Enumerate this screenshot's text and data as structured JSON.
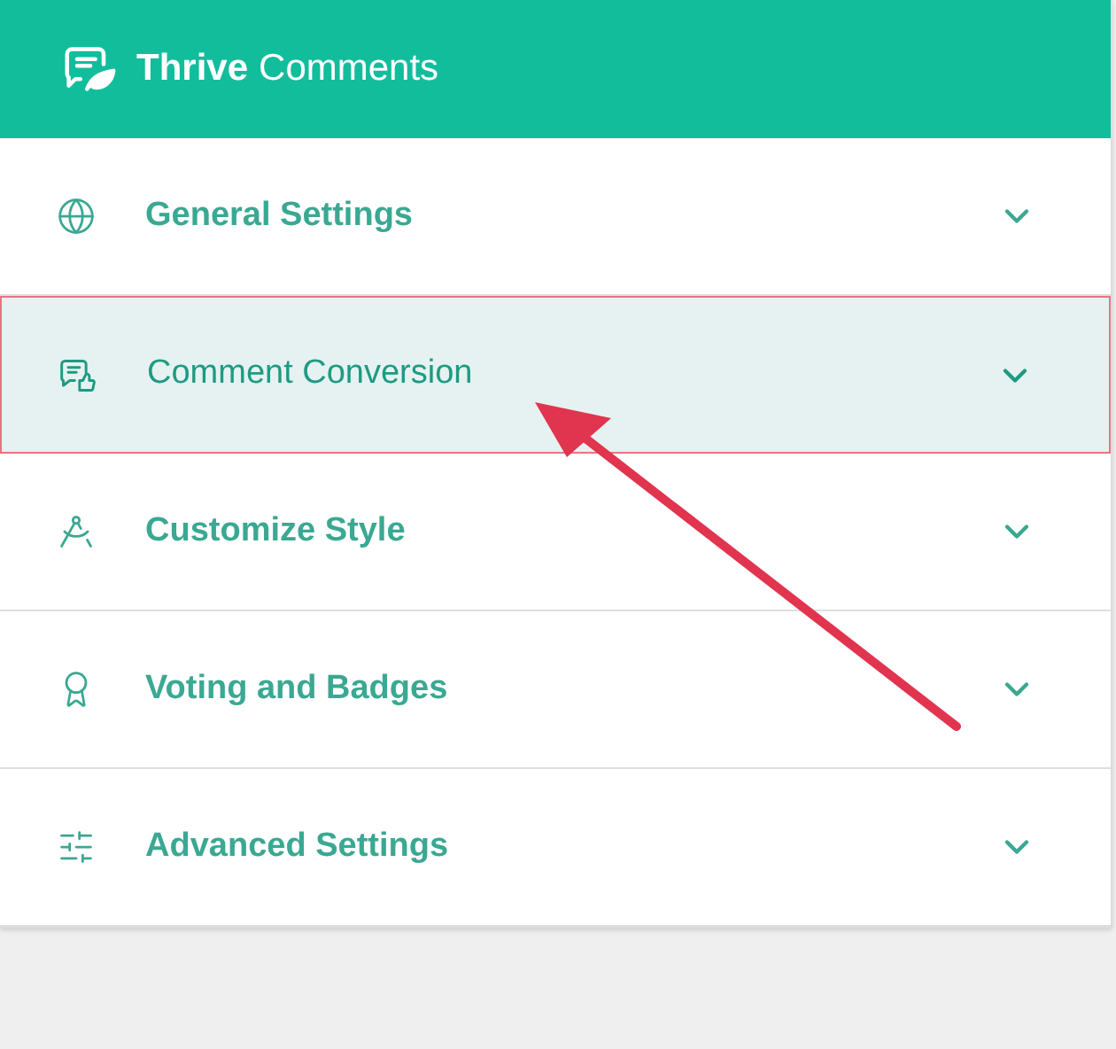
{
  "header": {
    "title_bold": "Thrive",
    "title_light": "Comments"
  },
  "menu": [
    {
      "label": "General Settings",
      "kind": "globe",
      "selected": false,
      "blurred": true
    },
    {
      "label": "Comment Conversion",
      "kind": "conversion",
      "selected": true,
      "blurred": false
    },
    {
      "label": "Customize Style",
      "kind": "style",
      "selected": false,
      "blurred": true
    },
    {
      "label": "Voting and Badges",
      "kind": "badge",
      "selected": false,
      "blurred": true
    },
    {
      "label": "Advanced Settings",
      "kind": "sliders",
      "selected": false,
      "blurred": true
    }
  ],
  "annotation": {
    "kind": "arrow"
  }
}
